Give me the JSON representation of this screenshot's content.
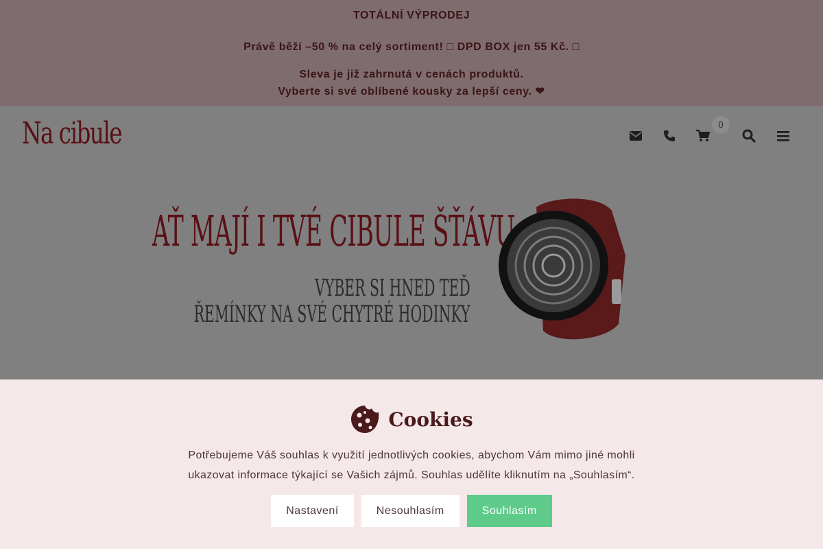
{
  "promo": {
    "title": "TOTÁLNÍ VÝPRODEJ",
    "line2": "Právě běží –50 % na celý sortiment! □ DPD BOX jen 55 Kč. □",
    "line3": "Sleva je již zahrnutá v cenách produktů.",
    "line4": "Vyberte si své oblíbené kousky za lepší ceny. ❤"
  },
  "header": {
    "logo": "Na cibule",
    "icons": [
      "envelope-icon",
      "phone-icon",
      "cart-icon",
      "search-icon",
      "menu-icon"
    ],
    "cart_count": "0"
  },
  "hero": {
    "headline": "AŤ MAJÍ I TVÉ CIBULE ŠŤÁVU",
    "sub1": "VYBER SI HNED TEĎ",
    "sub2": "ŘEMÍNKY NA SVÉ CHYTRÉ HODINKY"
  },
  "cookies": {
    "title": "Cookies",
    "text": "Potřebujeme Váš souhlas k využití jednotlivých cookies, abychom Vám mimo jiné mohli ukazovat informace týkající se Vašich zájmů. Souhlas udělíte kliknutím na „Souhlasím“.",
    "btn_settings": "Nastavení",
    "btn_decline": "Nesouhlasím",
    "btn_accept": "Souhlasím"
  },
  "colors": {
    "brand": "#5a0f14",
    "accept": "#5fcb8b",
    "panel": "#f5e8e9"
  }
}
